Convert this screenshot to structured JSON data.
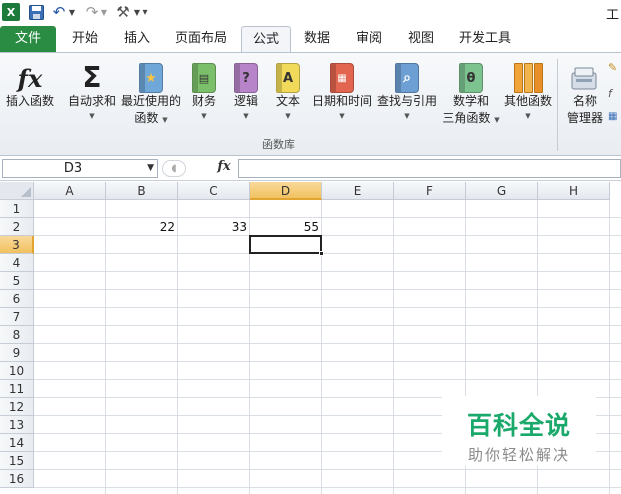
{
  "app": {
    "title_partial": "工",
    "excel_icon": "X"
  },
  "quick_access": {
    "icons": [
      "excel-icon",
      "save-icon",
      "undo-icon",
      "redo-icon",
      "tools-icon",
      "customize-icon"
    ]
  },
  "tabs": [
    {
      "label": "文件",
      "type": "file"
    },
    {
      "label": "开始"
    },
    {
      "label": "插入"
    },
    {
      "label": "页面布局"
    },
    {
      "label": "公式",
      "active": true
    },
    {
      "label": "数据"
    },
    {
      "label": "审阅"
    },
    {
      "label": "视图"
    },
    {
      "label": "开发工具"
    }
  ],
  "ribbon": {
    "buttons": [
      {
        "line1": "插入函数",
        "line2": "",
        "icon": "fx-icon"
      },
      {
        "line1": "自动求和",
        "line2": "",
        "icon": "sigma-icon",
        "dropdown": true
      },
      {
        "line1": "最近使用的",
        "line2": "函数",
        "icon": "star-book-icon",
        "dropdown": true
      },
      {
        "line1": "财务",
        "line2": "",
        "icon": "finance-book-icon",
        "dropdown": true
      },
      {
        "line1": "逻辑",
        "line2": "",
        "icon": "logic-book-icon",
        "dropdown": true
      },
      {
        "line1": "文本",
        "line2": "",
        "icon": "text-book-icon",
        "dropdown": true
      },
      {
        "line1": "日期和时间",
        "line2": "",
        "icon": "datetime-book-icon",
        "dropdown": true
      },
      {
        "line1": "查找与引用",
        "line2": "",
        "icon": "lookup-book-icon",
        "dropdown": true
      },
      {
        "line1": "数学和",
        "line2": "三角函数",
        "icon": "math-book-icon",
        "dropdown": true
      },
      {
        "line1": "其他函数",
        "line2": "",
        "icon": "more-functions-icon",
        "dropdown": true
      },
      {
        "line1": "名称",
        "line2": "管理器",
        "icon": "name-manager-icon"
      }
    ],
    "group_label": "函数库",
    "book_glyphs": {
      "star": "★",
      "logic": "?",
      "text": "A",
      "math": "θ"
    }
  },
  "formula_bar": {
    "name_box": "D3",
    "fx_label": "fx",
    "formula": ""
  },
  "sheet": {
    "columns": [
      "A",
      "B",
      "C",
      "D",
      "E",
      "F",
      "G",
      "H"
    ],
    "rows": [
      "1",
      "2",
      "3",
      "4",
      "5",
      "6",
      "7",
      "8",
      "9",
      "10",
      "11",
      "12",
      "13",
      "14",
      "15",
      "16"
    ],
    "selected_column": "D",
    "selected_row": "3",
    "cells": {
      "B2": "22",
      "C2": "33",
      "D2": "55"
    }
  },
  "watermark": {
    "title": "百科全说",
    "subtitle": "助你轻松解决"
  },
  "colors": {
    "file_tab": "#2a8c43",
    "selected_header": "#f1c15f",
    "watermark_green": "#1aa96b"
  }
}
